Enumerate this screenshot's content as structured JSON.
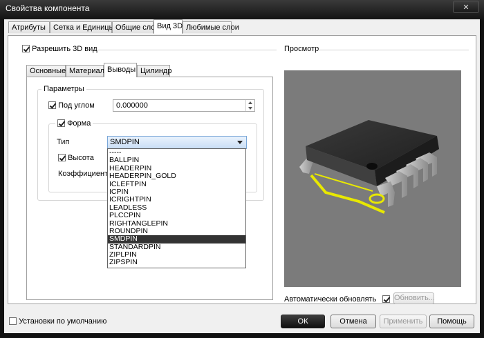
{
  "window": {
    "title": "Свойства компонента",
    "close_glyph": "✕"
  },
  "tabs": [
    "Атрибуты",
    "Сетка и Единицы",
    "Общие слои",
    "Вид 3D",
    "Любимые слои"
  ],
  "active_tab": "Вид 3D",
  "enable3d": {
    "label": "Разрешить 3D вид",
    "checked": true
  },
  "subtabs": [
    "Основные",
    "Материал",
    "Выводы",
    "Цилиндр"
  ],
  "active_subtab": "Выводы",
  "params": {
    "group_label": "Параметры",
    "angle_label": "Под углом",
    "angle_checked": true,
    "angle_value": "0.000000",
    "form_label": "Форма",
    "form_checked": true,
    "type_label": "Тип",
    "type_value": "SMDPIN",
    "height_label": "Высота",
    "height_checked": true,
    "coef_label": "Коэффициент"
  },
  "type_options": [
    "-----",
    "BALLPIN",
    "HEADERPIN",
    "HEADERPIN_GOLD",
    "ICLEFTPIN",
    "ICPIN",
    "ICRIGHTPIN",
    "LEADLESS",
    "PLCCPIN",
    "RIGHTANGLEPIN",
    "ROUNDPIN",
    "SMDPIN",
    "STANDARDPIN",
    "ZIPLPIN",
    "ZIPSPIN"
  ],
  "selected_option": "SMDPIN",
  "preview": {
    "label": "Просмотр",
    "auto_update_label": "Автоматически обновлять",
    "auto_update_checked": true,
    "update_button": "Обновить..."
  },
  "footer": {
    "defaults_label": "Установки по умолчанию",
    "defaults_checked": false,
    "ok": "ОК",
    "cancel": "Отмена",
    "apply": "Применить",
    "help": "Помощь"
  },
  "colors": {
    "pad_yellow": "#e8e800",
    "preview_bg": "#7b7b7b",
    "body_dark": "#2a2a2a"
  }
}
